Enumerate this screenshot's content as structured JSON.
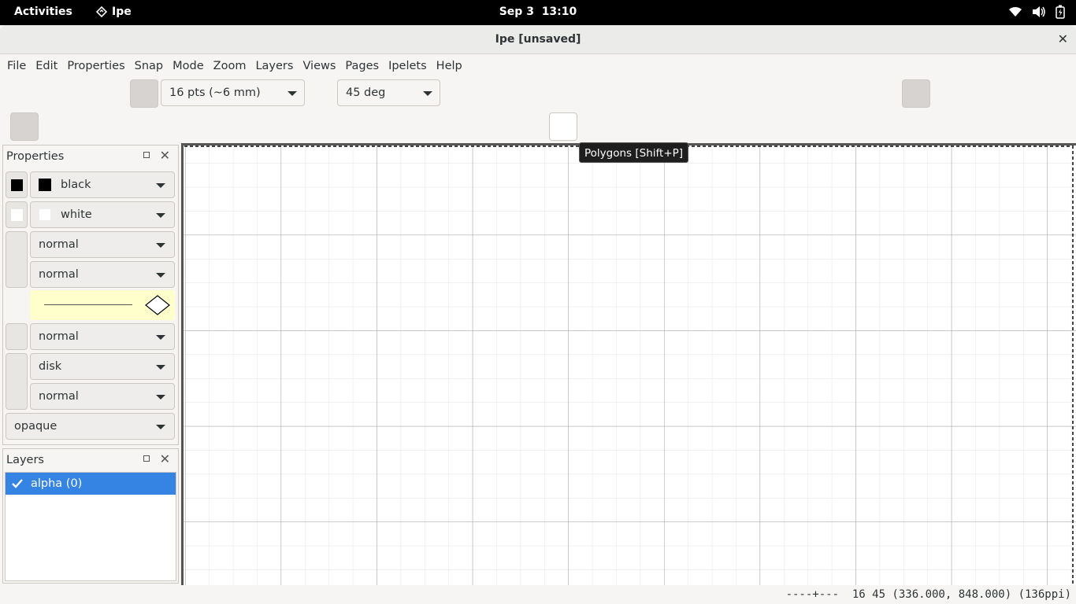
{
  "topbar": {
    "activities": "Activities",
    "app_name": "Ipe",
    "date": "Sep 3",
    "time": "13:10",
    "icons": [
      "wifi-icon",
      "volume-icon",
      "battery-icon"
    ]
  },
  "window": {
    "title": "Ipe [unsaved]"
  },
  "menubar": {
    "items": [
      "File",
      "Edit",
      "Properties",
      "Snap",
      "Mode",
      "Zoom",
      "Layers",
      "Views",
      "Pages",
      "Ipelets",
      "Help"
    ]
  },
  "toolbar": {
    "grid_size": "16 pts (~6 mm)",
    "angle": "45 deg",
    "tooltip": "Polygons [Shift+P]"
  },
  "properties": {
    "title": "Properties",
    "stroke_color": "black",
    "fill_color": "white",
    "pen": "normal",
    "dash": "normal",
    "text_size": "normal",
    "mark_shape": "disk",
    "symbol_size": "normal",
    "opacity": "opaque",
    "colors": {
      "stroke": "#000000",
      "fill": "#ffffff",
      "arrow_preview_bg": "#ffffcc"
    }
  },
  "layers": {
    "title": "Layers",
    "items": [
      {
        "label": "alpha (0)",
        "checked": true
      }
    ]
  },
  "status": {
    "text": "----+---  16 45 (336.000, 848.000) (136ppi)"
  },
  "colors": {
    "accent": "#3584e4",
    "topbar": "#000000",
    "grid_major": "#9a9a9a",
    "grid_minor": "#e0e0e0"
  }
}
